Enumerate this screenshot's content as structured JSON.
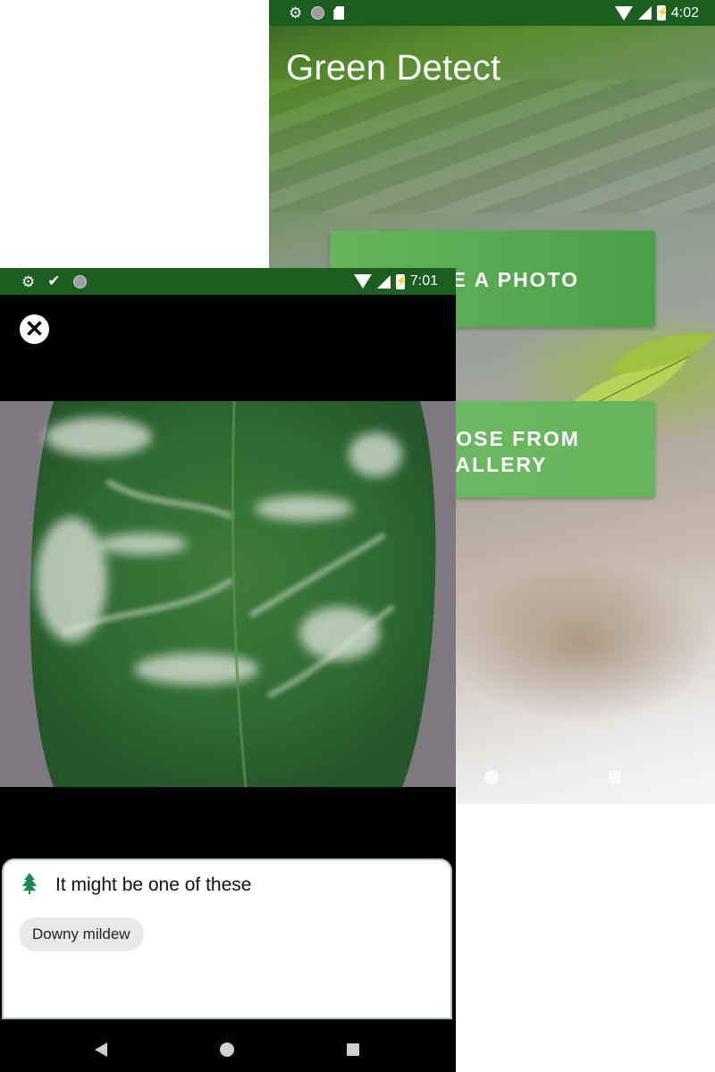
{
  "back_screen": {
    "status_bar": {
      "time": "4:02",
      "icons": [
        "gear-icon",
        "circle-icon",
        "sd-card-icon",
        "wifi-icon",
        "cell-signal-icon",
        "battery-charging-icon"
      ]
    },
    "app_title": "Green Detect",
    "buttons": {
      "take_photo": "TAKE A PHOTO",
      "gallery": "CHOOSE FROM\nGALLERY"
    },
    "nav": [
      "home-icon",
      "recents-icon"
    ],
    "colors": {
      "status_bar": "#1b5e20",
      "button": "#5fae55"
    }
  },
  "front_screen": {
    "status_bar": {
      "time": "7:01",
      "icons": [
        "gear-icon",
        "check-icon",
        "circle-icon",
        "wifi-icon",
        "cell-signal-icon",
        "battery-charging-icon"
      ]
    },
    "close_icon": "close-icon",
    "image": "leaf-with-white-mildew",
    "result": {
      "icon": "tree-icon",
      "heading": "It might be one of these",
      "chips": [
        "Downy mildew"
      ]
    },
    "nav": [
      "back-icon",
      "home-icon",
      "recents-icon"
    ]
  }
}
